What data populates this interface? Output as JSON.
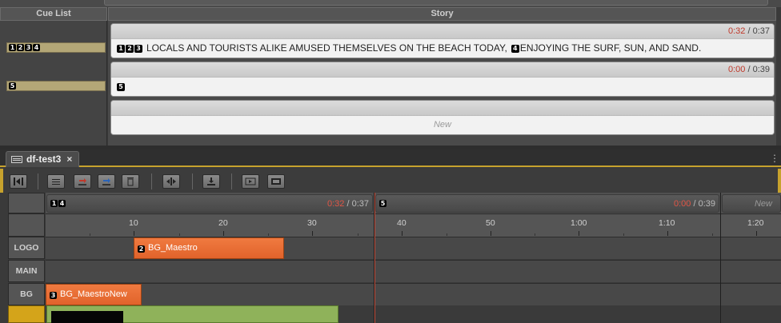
{
  "cue_list": {
    "header_cue": "Cue List",
    "header_story": "Story",
    "rows": [
      {
        "badges": [
          "1",
          "2",
          "3",
          "4"
        ]
      },
      {
        "badges": [
          "5"
        ]
      }
    ]
  },
  "story": {
    "blocks": [
      {
        "time_elapsed": "0:32",
        "time_sep": " / ",
        "time_total": "0:37",
        "lead_badges": [
          "1",
          "2",
          "3"
        ],
        "text1": "LOCALS AND TOURISTS ALIKE AMUSED THEMSELVES ON THE BEACH TODAY,",
        "mid_badge": "4",
        "text2": "ENJOYING THE SURF, SUN, AND SAND."
      },
      {
        "time_elapsed": "0:00",
        "time_sep": " / ",
        "time_total": "0:39",
        "lead_badges": [
          "5"
        ]
      }
    ],
    "new_label": "New"
  },
  "timeline": {
    "tab_title": "df-test3",
    "tab_close": "×",
    "tab_menu": "⋮",
    "segments": [
      {
        "badges": [
          "1",
          "4"
        ],
        "time_elapsed": "0:32",
        "time_sep": " / ",
        "time_total": "0:37"
      },
      {
        "badges": [
          "5"
        ],
        "time_elapsed": "0:00",
        "time_sep": " / ",
        "time_total": "0:39"
      },
      {
        "new_label": "New"
      }
    ],
    "ruler_ticks": [
      "10",
      "20",
      "30",
      "40",
      "50",
      "1:00",
      "1:10",
      "1:20"
    ],
    "tracks": [
      {
        "label": "LOGO",
        "clips": [
          {
            "badge": "2",
            "name": "BG_Maestro"
          }
        ]
      },
      {
        "label": "MAIN",
        "clips": []
      },
      {
        "label": "BG",
        "clips": [
          {
            "badge": "3",
            "name": "BG_MaestroNew"
          }
        ]
      }
    ],
    "toolbar_icons": [
      "first-frame-icon",
      "trim-icon",
      "insert-red-icon",
      "insert-blue-icon",
      "trash-icon",
      "split-icon",
      "download-icon",
      "filmstrip-icon",
      "film-icon"
    ]
  },
  "colors": {
    "accent": "#c7a22d",
    "clip_orange": "#e96b30",
    "video_green": "#8fb25a",
    "elapsed_red": "#c0392b"
  }
}
